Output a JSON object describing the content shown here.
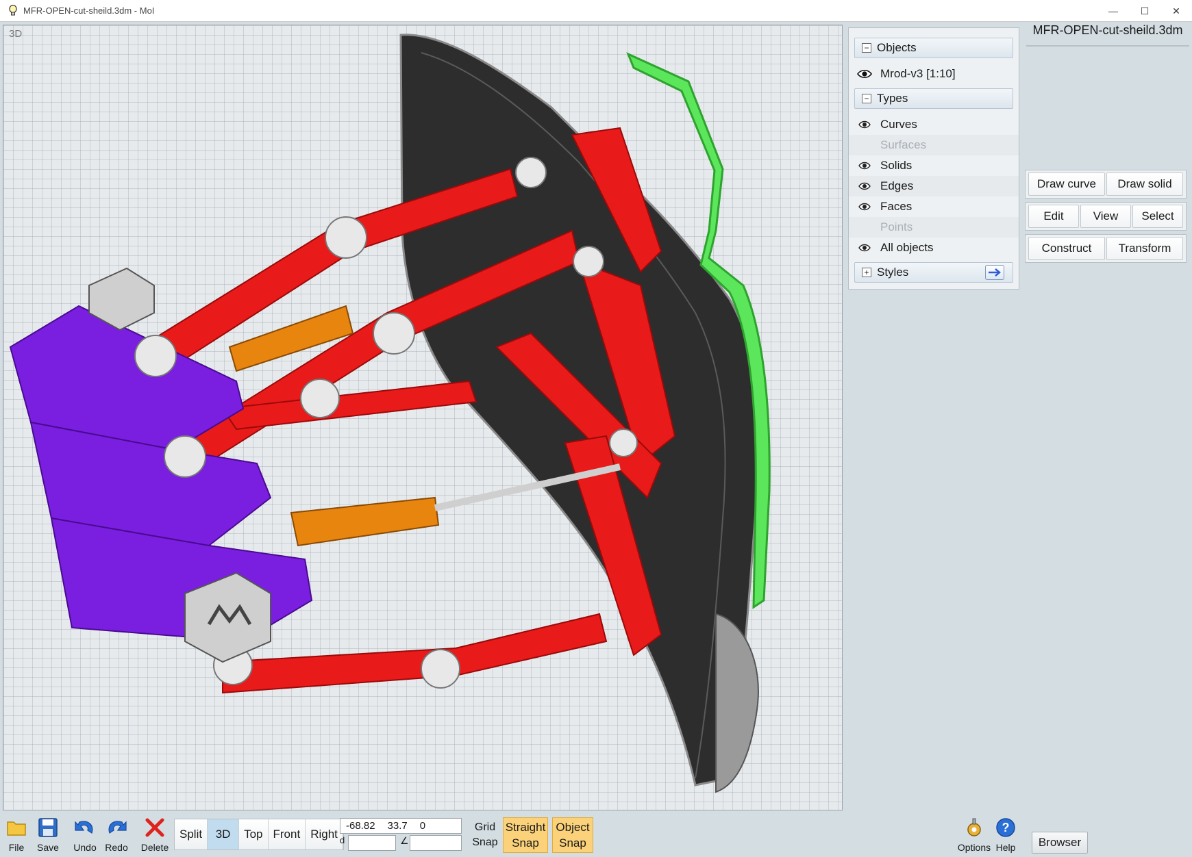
{
  "window": {
    "title": "MFR-OPEN-cut-sheild.3dm - MoI",
    "controls": {
      "minimize": "—",
      "maximize": "☐",
      "close": "✕"
    }
  },
  "viewport": {
    "label": "3D"
  },
  "panel": {
    "objects_header": "Objects",
    "object_name": "Mrod-v3 [1:10]",
    "types_header": "Types",
    "types": [
      {
        "label": "Curves",
        "visible": true
      },
      {
        "label": "Surfaces",
        "visible": false
      },
      {
        "label": "Solids",
        "visible": true
      },
      {
        "label": "Edges",
        "visible": true
      },
      {
        "label": "Faces",
        "visible": true
      },
      {
        "label": "Points",
        "visible": false
      },
      {
        "label": "All objects",
        "visible": true
      }
    ],
    "styles_header": "Styles",
    "expand_minus": "−",
    "expand_plus": "+"
  },
  "filename": "MFR-OPEN-cut-sheild.3dm",
  "commands": {
    "draw_curve": "Draw curve",
    "draw_solid": "Draw solid",
    "edit": "Edit",
    "view": "View",
    "select": "Select",
    "construct": "Construct",
    "transform": "Transform"
  },
  "toolbar": {
    "file": "File",
    "save": "Save",
    "undo": "Undo",
    "redo": "Redo",
    "delete": "Delete",
    "views": [
      "Split",
      "3D",
      "Top",
      "Front",
      "Right"
    ],
    "active_view": "3D",
    "coords": {
      "x": "-68.82",
      "y": "33.7",
      "z": "0",
      "d_label": "d",
      "angle_label": "∠"
    },
    "grid_snap_line1": "Grid",
    "grid_snap_line2": "Snap",
    "straight_snap_line1": "Straight",
    "straight_snap_line2": "Snap",
    "object_snap_line1": "Object",
    "object_snap_line2": "Snap",
    "options": "Options",
    "help": "Help",
    "browser": "Browser"
  },
  "colors": {
    "accent_snap": "#fbd27a",
    "active_view": "#c2dcef",
    "model_red": "#e81a1a",
    "model_purple": "#7a1fe0",
    "model_orange": "#e8850f",
    "model_green": "#5ce65c",
    "model_dark": "#2b2b2b"
  }
}
